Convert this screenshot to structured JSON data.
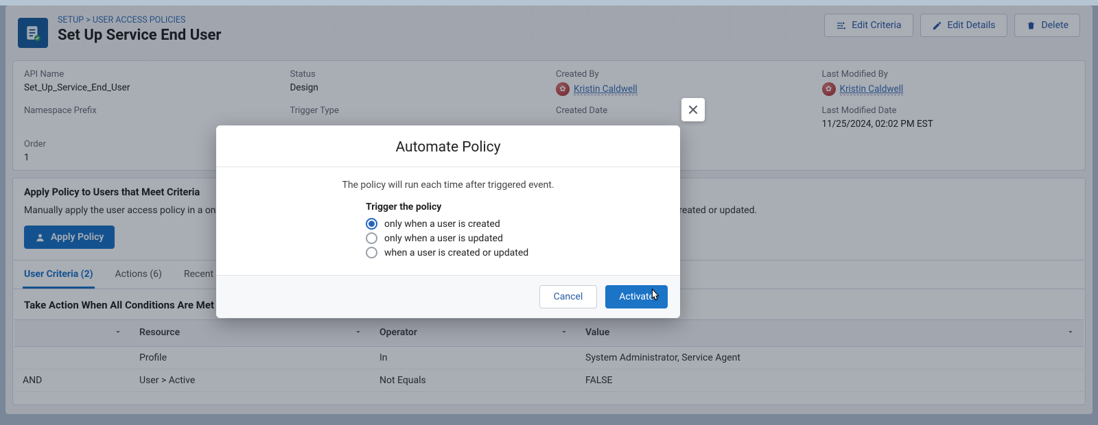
{
  "breadcrumb": {
    "setup": "SETUP",
    "sep": ">",
    "link": "USER ACCESS POLICIES"
  },
  "page_title": "Set Up Service End User",
  "header_buttons": {
    "edit_criteria": "Edit Criteria",
    "edit_details": "Edit Details",
    "delete": "Delete"
  },
  "details": {
    "api_name_label": "API Name",
    "api_name_value": "Set_Up_Service_End_User",
    "status_label": "Status",
    "status_value": "Design",
    "created_by_label": "Created By",
    "created_by_name": "Kristin Caldwell",
    "last_mod_by_label": "Last Modified By",
    "last_mod_by_name": "Kristin Caldwell",
    "namespace_label": "Namespace Prefix",
    "namespace_value": "",
    "trigger_type_label": "Trigger Type",
    "trigger_type_value": "",
    "created_date_label": "Created Date",
    "created_date_value": "",
    "last_mod_date_label": "Last Modified Date",
    "last_mod_date_value": "11/25/2024, 02:02 PM EST",
    "order_label": "Order",
    "order_value": "1"
  },
  "apply": {
    "title": "Apply Policy to Users that Meet Criteria",
    "desc_full": "Manually apply the user access policy in a one-time operation, or configure the policy to run automatically after a triggering event, such as when a user is created or updated.",
    "button": "Apply Policy"
  },
  "tabs": {
    "criteria": "User Criteria (2)",
    "actions": "Actions (6)",
    "recent": "Recent User Activity"
  },
  "criteria": {
    "heading": "Take Action When All Conditions Are Met",
    "headers": {
      "logic": "",
      "resource": "Resource",
      "operator": "Operator",
      "value": "Value"
    },
    "rows": [
      {
        "logic": "",
        "resource": "Profile",
        "operator": "In",
        "value": "System Administrator, Service Agent"
      },
      {
        "logic": "AND",
        "resource": "User > Active",
        "operator": "Not Equals",
        "value": "FALSE"
      }
    ]
  },
  "modal": {
    "title": "Automate Policy",
    "subtitle": "The policy will run each time after triggered event.",
    "trigger_label": "Trigger the policy",
    "options": {
      "created": "only when a user is created",
      "updated": "only when a user is updated",
      "both": "when a user is created or updated"
    },
    "selected": "created",
    "cancel": "Cancel",
    "activate": "Activate"
  }
}
